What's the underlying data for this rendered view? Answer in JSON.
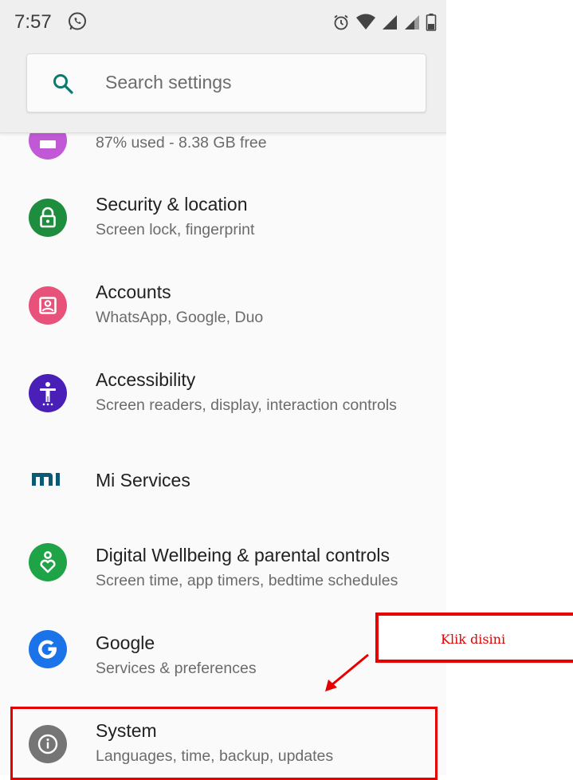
{
  "status_bar": {
    "time": "7:57",
    "notification_icon": "whatsapp-icon",
    "right_icons": [
      "alarm-icon",
      "wifi-icon",
      "signal-icon",
      "signal-icon",
      "battery-icon"
    ]
  },
  "search": {
    "placeholder": "Search settings",
    "icon": "search-icon"
  },
  "settings": [
    {
      "title": "",
      "subtitle": "87% used - 8.38 GB free",
      "icon": "storage-icon",
      "color": "#c158d6"
    },
    {
      "title": "Security & location",
      "subtitle": "Screen lock, fingerprint",
      "icon": "lock-icon",
      "color": "#1e8e3e"
    },
    {
      "title": "Accounts",
      "subtitle": "WhatsApp, Google, Duo",
      "icon": "account-box-icon",
      "color": "#e8527a"
    },
    {
      "title": "Accessibility",
      "subtitle": "Screen readers, display, interaction controls",
      "icon": "accessibility-icon",
      "color": "#4a1fb8"
    },
    {
      "title": "Mi Services",
      "subtitle": "",
      "icon": "mi-logo-icon",
      "color": "#0b5a73"
    },
    {
      "title": "Digital Wellbeing & parental controls",
      "subtitle": "Screen time, app timers, bedtime schedules",
      "icon": "wellbeing-icon",
      "color": "#1ea446"
    },
    {
      "title": "Google",
      "subtitle": "Services & preferences",
      "icon": "google-icon",
      "color": "#1a73e8"
    },
    {
      "title": "System",
      "subtitle": "Languages, time, backup, updates",
      "icon": "info-icon",
      "color": "#757575"
    }
  ],
  "annotation": {
    "callout_text": "Klik disini",
    "color": "#e60000"
  }
}
